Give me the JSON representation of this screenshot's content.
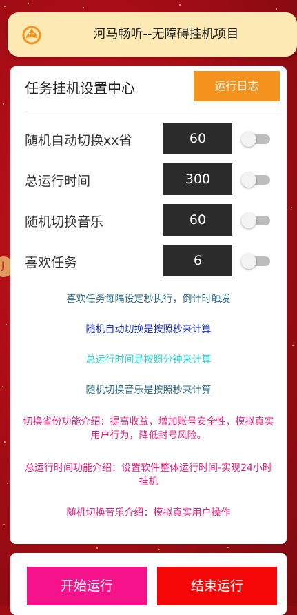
{
  "header": {
    "logo_icon": "film-reel-icon",
    "title": "河马畅听--无障碍挂机项目"
  },
  "panel": {
    "title": "任务挂机设置中心",
    "log_button": "运行日志"
  },
  "settings": [
    {
      "label": "随机自动切换xx省",
      "value": "60",
      "enabled": false
    },
    {
      "label": "总运行时间",
      "value": "300",
      "enabled": false
    },
    {
      "label": "随机切换音乐",
      "value": "60",
      "enabled": false
    },
    {
      "label": "喜欢任务",
      "value": "6",
      "enabled": false
    }
  ],
  "notes": [
    {
      "text": "喜欢任务每隔设定秒执行，倒计时触发",
      "color": "#2a6a86"
    },
    {
      "text": "随机自动切换是按照秒来计算",
      "color": "#1a2fc4"
    },
    {
      "text": "总运行时间是按照分钟来计算",
      "color": "#27d6d8"
    },
    {
      "text": "随机切换音乐是按照秒来计算",
      "color": "#2a6a86"
    },
    {
      "text": "切换省份功能介绍：提高收益，增加账号安全性，模拟真实用户行为，降低封号风险。",
      "color": "#e81e7a"
    },
    {
      "text": "总运行时间功能介绍：设置软件整体运行时间-实现24小时挂机",
      "color": "#e81e7a"
    },
    {
      "text": "随机切换音乐介绍：模拟真实用户操作",
      "color": "#e81e7a"
    }
  ],
  "actions": {
    "start": "开始运行",
    "stop": "结束运行"
  },
  "edge_badge": "J",
  "colors": {
    "accent_orange": "#f5931f",
    "start_pink": "#f5128a",
    "stop_red": "#f50707",
    "header_cream": "#fce9b4",
    "background_red": "#b30f18"
  }
}
